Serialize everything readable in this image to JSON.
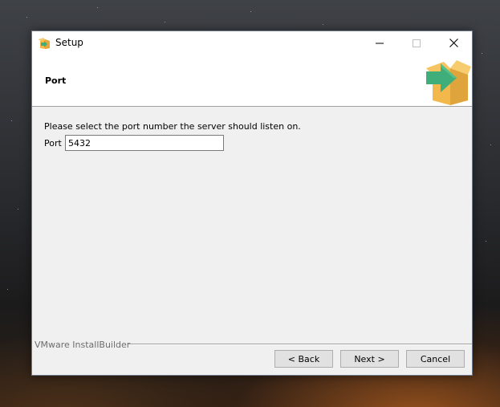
{
  "window": {
    "title": "Setup",
    "icon": "installer-box-icon",
    "controls": {
      "minimize": "minimize-icon",
      "maximize": "maximize-icon",
      "close": "close-icon"
    }
  },
  "header": {
    "title": "Port",
    "icon": "installer-box-arrow-icon"
  },
  "content": {
    "prompt": "Please select the port number the server should listen on.",
    "port_label": "Port",
    "port_value": "5432"
  },
  "footer": {
    "brand": "VMware InstallBuilder",
    "back_label": "< Back",
    "next_label": "Next >",
    "cancel_label": "Cancel"
  },
  "colors": {
    "window_bg": "#f0f0f0",
    "header_bg": "#ffffff",
    "box_orange": "#f2b84b",
    "arrow_green": "#3fae7a"
  }
}
